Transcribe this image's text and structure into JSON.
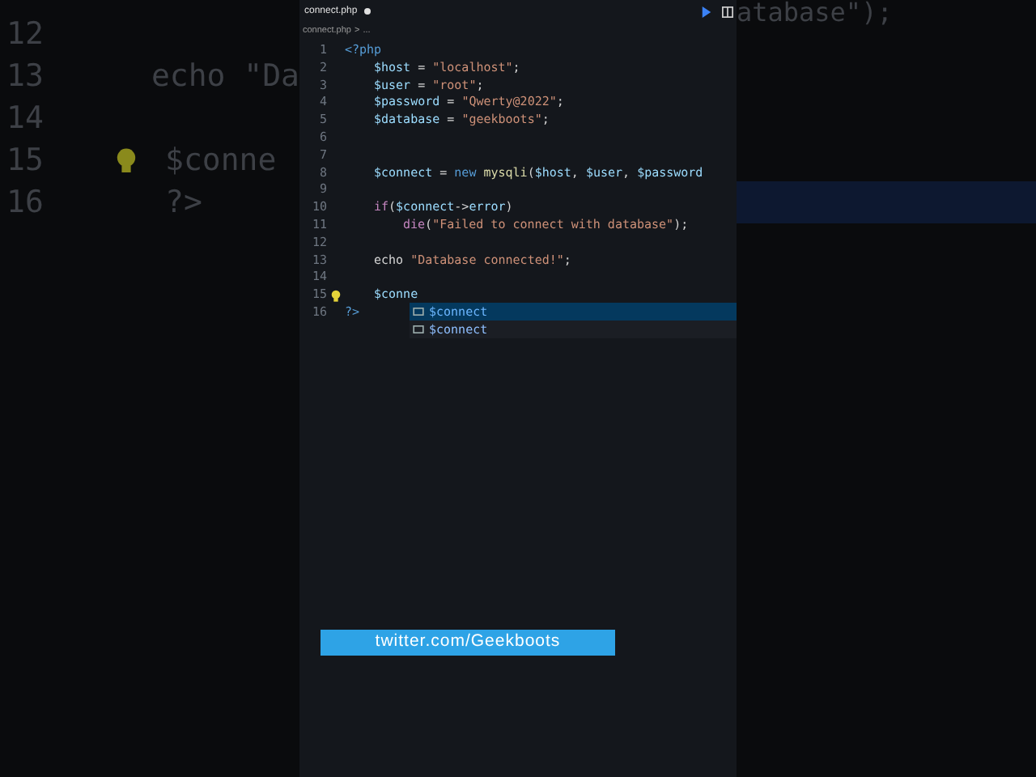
{
  "backdrop_left": {
    "lines": [
      {
        "number": "12"
      },
      {
        "number": "13",
        "code": "echo \"Da"
      },
      {
        "number": "14"
      },
      {
        "number": "15",
        "code": "$conne",
        "lightbulb": true
      },
      {
        "number": "16",
        "code": "?>"
      }
    ]
  },
  "backdrop_right": {
    "text": "atabase\");"
  },
  "editor": {
    "tab": {
      "title": "connect.php",
      "modified": true
    },
    "breadcrumb": [
      "connect.php",
      ">",
      "..."
    ],
    "lines": [
      {
        "number": "1",
        "tokens": [
          {
            "kind": "tag",
            "text": "<?php"
          }
        ],
        "children": [
          {
            "number": "2",
            "tokens": [
              {
                "kind": "var",
                "text": "$host"
              },
              {
                "kind": "plain",
                "text": " = "
              },
              {
                "kind": "string",
                "text": "\"localhost\""
              },
              {
                "kind": "plain",
                "text": ";"
              }
            ]
          },
          {
            "number": "3",
            "tokens": [
              {
                "kind": "var",
                "text": "$user"
              },
              {
                "kind": "plain",
                "text": " = "
              },
              {
                "kind": "string",
                "text": "\"root\""
              },
              {
                "kind": "plain",
                "text": ";"
              }
            ]
          },
          {
            "number": "4",
            "tokens": [
              {
                "kind": "var",
                "text": "$password"
              },
              {
                "kind": "plain",
                "text": " = "
              },
              {
                "kind": "string",
                "text": "\"Qwerty@2022\""
              },
              {
                "kind": "plain",
                "text": ";"
              }
            ]
          },
          {
            "number": "5",
            "tokens": [
              {
                "kind": "var",
                "text": "$database"
              },
              {
                "kind": "plain",
                "text": " = "
              },
              {
                "kind": "string",
                "text": "\"geekboots\""
              },
              {
                "kind": "plain",
                "text": ";"
              }
            ]
          },
          {
            "number": "6"
          },
          {
            "number": "7"
          },
          {
            "number": "8",
            "tokens": [
              {
                "kind": "var",
                "text": "$connect"
              },
              {
                "kind": "plain",
                "text": " = "
              },
              {
                "kind": "keyword",
                "text": "new"
              },
              {
                "kind": "func",
                "text": " mysqli"
              },
              {
                "kind": "plain",
                "text": "("
              },
              {
                "kind": "var",
                "text": "$host"
              },
              {
                "kind": "plain",
                "text": ", "
              },
              {
                "kind": "var",
                "text": "$user"
              },
              {
                "kind": "plain",
                "text": ", "
              },
              {
                "kind": "var",
                "text": "$password"
              }
            ]
          },
          {
            "number": "9"
          },
          {
            "number": "10",
            "tokens": [
              {
                "kind": "control",
                "text": "if"
              },
              {
                "kind": "plain",
                "text": "("
              },
              {
                "kind": "var",
                "text": "$connect"
              },
              {
                "kind": "plain",
                "text": "->"
              },
              {
                "kind": "var",
                "text": "error"
              },
              {
                "kind": "plain",
                "text": ")"
              }
            ],
            "children": [
              {
                "number": "11",
                "tokens": [
                  {
                    "kind": "control",
                    "text": "die"
                  },
                  {
                    "kind": "plain",
                    "text": "("
                  },
                  {
                    "kind": "string",
                    "text": "\"Failed to connect with database\""
                  },
                  {
                    "kind": "plain",
                    "text": ");"
                  }
                ]
              }
            ]
          },
          {
            "number": "12"
          },
          {
            "number": "13",
            "tokens": [
              {
                "kind": "plain",
                "text": "echo "
              },
              {
                "kind": "string",
                "text": "\"Database connected!\""
              },
              {
                "kind": "plain",
                "text": ";"
              }
            ]
          },
          {
            "number": "14"
          },
          {
            "number": "15",
            "lightbulb": true,
            "tokens": [
              {
                "kind": "var",
                "text": "$conne"
              }
            ]
          }
        ]
      },
      {
        "number": "16",
        "tokens": [
          {
            "kind": "tag",
            "text": "?>"
          }
        ]
      }
    ],
    "suggestions": [
      {
        "text": "$connect",
        "selected": true
      },
      {
        "text": "$connect",
        "selected": false
      }
    ]
  },
  "banner": {
    "text": "twitter.com/Geekboots"
  }
}
